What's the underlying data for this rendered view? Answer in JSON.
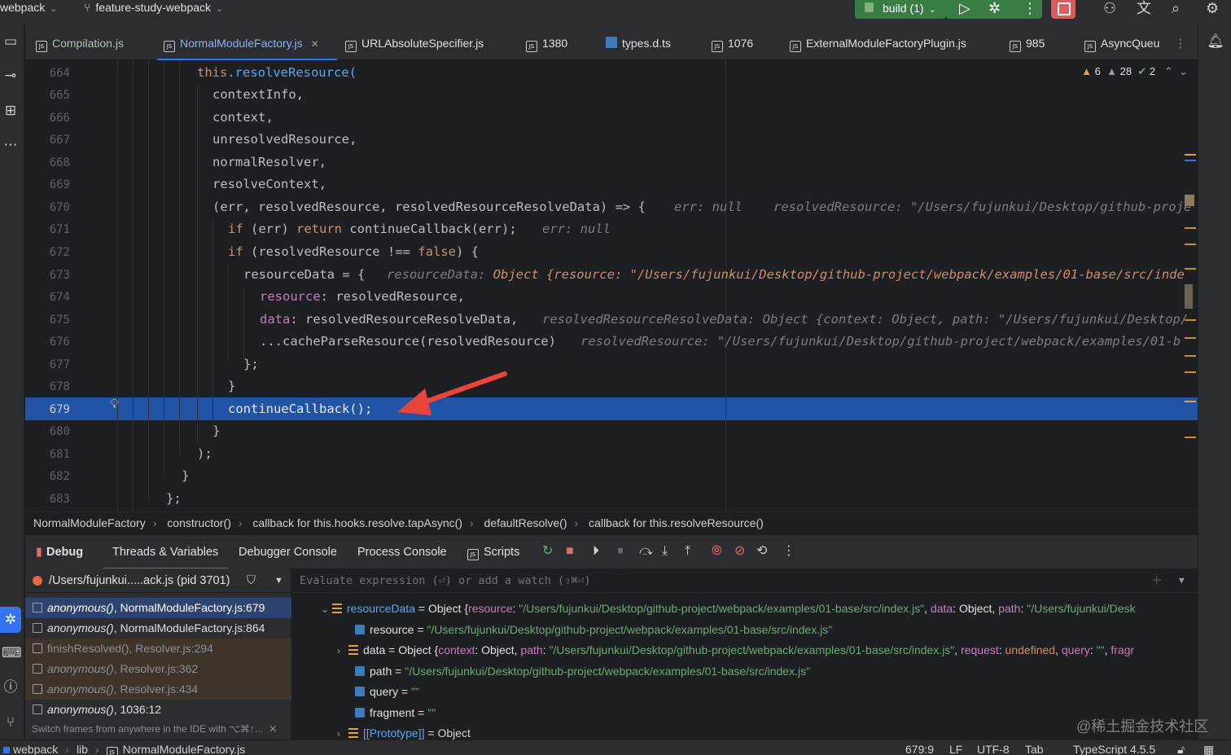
{
  "titlebar": {
    "project": "webpack",
    "branch": "feature-study-webpack",
    "run_config": "build (1)"
  },
  "tabs": [
    {
      "label": "Compilation.js"
    },
    {
      "label": "NormalModuleFactory.js"
    },
    {
      "label": "URLAbsoluteSpecifier.js"
    },
    {
      "label": "1380"
    },
    {
      "label": "types.d.ts"
    },
    {
      "label": "1076"
    },
    {
      "label": "ExternalModuleFactoryPlugin.js"
    },
    {
      "label": "985"
    },
    {
      "label": "AsyncQueu"
    }
  ],
  "problems": {
    "warnings_a": "6",
    "warnings_b": "28",
    "ok": "2"
  },
  "editor": {
    "line_numbers": [
      "664",
      "665",
      "666",
      "667",
      "668",
      "669",
      "670",
      "671",
      "672",
      "673",
      "674",
      "675",
      "676",
      "677",
      "678",
      "679",
      "680",
      "681",
      "682",
      "683"
    ],
    "current_line": "679",
    "lines": {
      "l664_this": "this",
      "l664_rest": ".resolveResource(",
      "l665": "contextInfo,",
      "l666": "context,",
      "l667": "unresolvedResource,",
      "l668": "normalResolver,",
      "l669": "resolveContext,",
      "l670": "(err, resolvedResource, resolvedResourceResolveData) => {",
      "l670_hint1": "err: null",
      "l670_hint2": "resolvedResource: \"/Users/fujunkui/Desktop/github-proje",
      "l671_if": "if",
      "l671_mid": " (err) ",
      "l671_return": "return",
      "l671_rest": " continueCallback(err);",
      "l671_hint": "err: null",
      "l672_if": "if",
      "l672_mid": " (resolvedResource !== ",
      "l672_false": "false",
      "l672_rest": ") {",
      "l673": "resourceData = {",
      "l673_hint_label": "resourceData: ",
      "l673_hint_val": "Object {resource: \"/Users/fujunkui/Desktop/github-project/webpack/examples/01-base/src/inde",
      "l674_key": "resource",
      "l674_rest": ": resolvedResource,",
      "l675_key": "data",
      "l675_rest": ": resolvedResourceResolveData,",
      "l675_hint": "resolvedResourceResolveData: Object {context: Object, path: \"/Users/fujunkui/Desktop/",
      "l676": "...cacheParseResource(resolvedResource)",
      "l676_hint": "resolvedResource: \"/Users/fujunkui/Desktop/github-project/webpack/examples/01-b",
      "l677": "};",
      "l678": "}",
      "l679": "continueCallback();",
      "l680": "}",
      "l681": ");",
      "l682": "}",
      "l683": "};"
    }
  },
  "breadcrumb": [
    "NormalModuleFactory",
    "constructor()",
    "callback for this.hooks.resolve.tapAsync()",
    "defaultResolve()",
    "callback for this.resolveResource()"
  ],
  "debug": {
    "title": "Debug",
    "tabs": [
      "Threads & Variables",
      "Debugger Console",
      "Process Console",
      "Scripts"
    ],
    "thread": "/Users/fujunkui.....ack.js (pid 3701)",
    "watch_placeholder": "Evaluate expression (⏎) or add a watch (⇧⌘⏎)",
    "frames": [
      {
        "fn": "anonymous()",
        "loc": ", NormalModuleFactory.js:679"
      },
      {
        "fn": "anonymous()",
        "loc": ", NormalModuleFactory.js:864"
      },
      {
        "fn": "finishResolved()",
        "loc": ", Resolver.js:294"
      },
      {
        "fn": "anonymous()",
        "loc": ", Resolver.js:362"
      },
      {
        "fn": "anonymous()",
        "loc": ", Resolver.js:434"
      },
      {
        "fn": "anonymous()",
        "loc": ", 1036:12"
      }
    ],
    "frames_hint": "Switch frames from anywhere in the IDE with ⌥⌘↑...",
    "variables": {
      "root_name": "resourceData",
      "root_eq": " = Object {",
      "root_k1": "resource",
      "root_v1": "\"/Users/fujunkui/Desktop/github-project/webpack/examples/01-base/src/index.js\"",
      "root_k2": "data",
      "root_v2": "Object",
      "root_k3": "path",
      "root_v3": "\"/Users/fujunkui/Desk",
      "resource_name": "resource",
      "resource_val": "\"/Users/fujunkui/Desktop/github-project/webpack/examples/01-base/src/index.js\"",
      "data_name": "data",
      "data_eq": " = Object {",
      "data_k1": "context",
      "data_v1": "Object",
      "data_k2": "path",
      "data_v2": "\"/Users/fujunkui/Desktop/github-project/webpack/examples/01-base/src/index.js\"",
      "data_k3": "request",
      "data_v3": "undefined",
      "data_k4": "query",
      "data_v4": "\"\"",
      "data_k5": "fragr",
      "path_name": "path",
      "path_val": "\"/Users/fujunkui/Desktop/github-project/webpack/examples/01-base/src/index.js\"",
      "query_name": "query",
      "query_val": "\"\"",
      "fragment_name": "fragment",
      "fragment_val": "\"\"",
      "proto_name": "[[Prototype]]",
      "proto_val": "Object"
    }
  },
  "watermark": "@稀土掘金技术社区",
  "statusbar": {
    "path": [
      "webpack",
      "lib",
      "NormalModuleFactory.js"
    ],
    "position": "679:9",
    "line_sep": "LF",
    "encoding": "UTF-8",
    "indent": "Tab",
    "language": "TypeScript 4.5.5"
  },
  "colors": {
    "accent": "#3574f0",
    "selection": "#2154a6",
    "run": "#3a7d44",
    "stop": "#db5c5c",
    "arrow": "#e8453c"
  }
}
